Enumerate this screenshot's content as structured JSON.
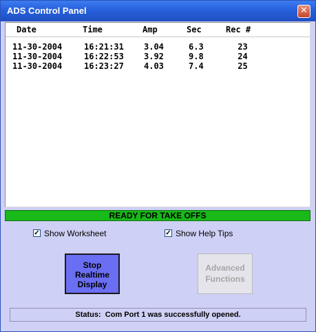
{
  "window": {
    "title": "ADS Control Panel",
    "close_glyph": "✕"
  },
  "table": {
    "headers": [
      "Date",
      "Time",
      "Amp",
      "Sec",
      "Rec #"
    ],
    "rows": [
      [
        "11-30-2004",
        "16:21:31",
        "3.04",
        "6.3",
        " 23"
      ],
      [
        "11-30-2004",
        "16:22:53",
        "3.92",
        "9.8",
        " 24"
      ],
      [
        "11-30-2004",
        "16:23:27",
        "4.03",
        "7.4",
        " 25"
      ]
    ]
  },
  "ready_text": "READY FOR TAKE OFFS",
  "options": {
    "show_worksheet": {
      "label": "Show Worksheet",
      "checked": true
    },
    "show_help_tips": {
      "label": "Show Help Tips",
      "checked": true
    },
    "check_glyph": "✓"
  },
  "buttons": {
    "stop_line1": "Stop",
    "stop_line2": "Realtime",
    "stop_line3": "Display",
    "advanced_line1": "Advanced",
    "advanced_line2": "Functions"
  },
  "status": {
    "prefix": "Status:",
    "message": "Com Port 1 was successfully opened."
  },
  "colors": {
    "title_bar": "#2760dc",
    "panel_bg": "#cfd0f5",
    "ready_green": "#18b918",
    "stop_button": "#6a6ef2",
    "disabled_button": "#e4e4ea"
  }
}
